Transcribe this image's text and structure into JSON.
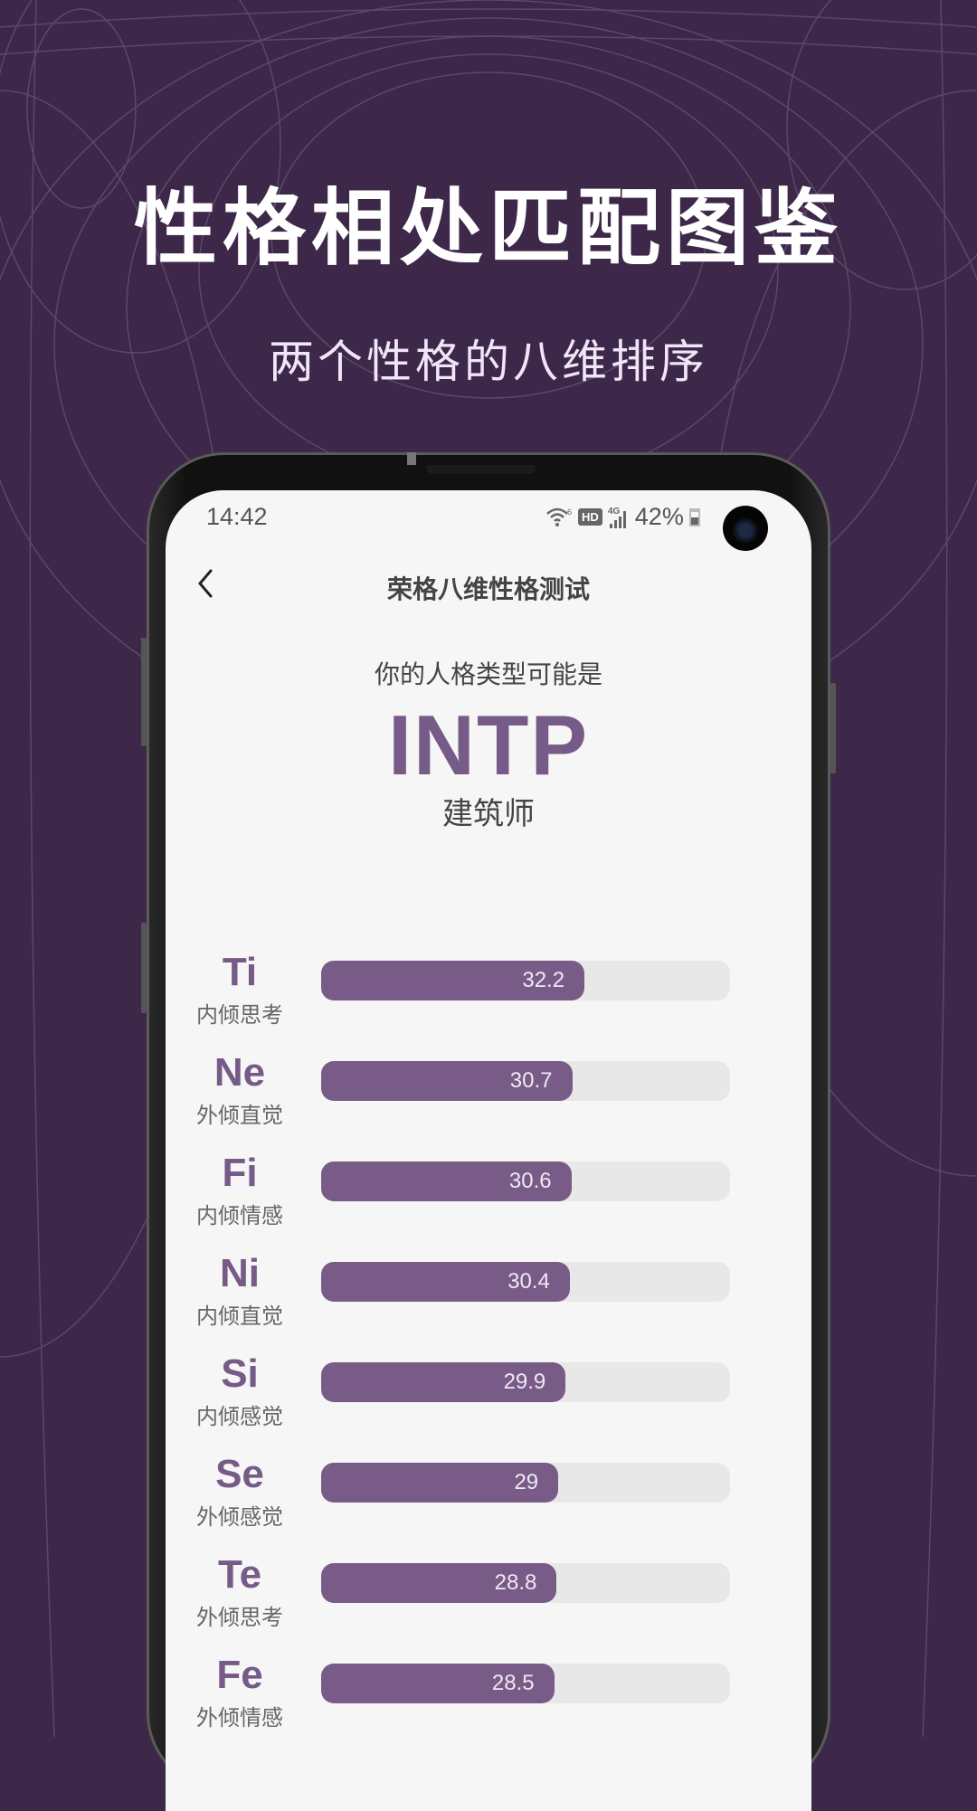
{
  "promo": {
    "title": "性格相处匹配图鉴",
    "subtitle": "两个性格的八维排序"
  },
  "status_bar": {
    "time": "14:42",
    "wifi_icon": "wifi-6-icon",
    "hd_label": "HD",
    "network_label": "4G",
    "signal_icon": "signal-bars-icon",
    "battery_percent": "42%",
    "battery_icon": "battery-icon"
  },
  "nav": {
    "back_icon": "‹",
    "title": "荣格八维性格测试"
  },
  "result": {
    "intro": "你的人格类型可能是",
    "type": "INTP",
    "type_name": "建筑师"
  },
  "colors": {
    "accent": "#785c87",
    "background": "#3d2849",
    "track": "#e8e8e8"
  },
  "chart_data": {
    "type": "bar",
    "orientation": "horizontal",
    "max": 50,
    "categories": [
      "Ti",
      "Ne",
      "Fi",
      "Ni",
      "Si",
      "Se",
      "Te",
      "Fe"
    ],
    "subtitles": [
      "内倾思考",
      "外倾直觉",
      "内倾情感",
      "内倾直觉",
      "内倾感觉",
      "外倾感觉",
      "外倾思考",
      "外倾情感"
    ],
    "values": [
      32.2,
      30.7,
      30.6,
      30.4,
      29.9,
      29,
      28.8,
      28.5
    ]
  },
  "functions": [
    {
      "code": "Ti",
      "name": "内倾思考",
      "value": "32.2"
    },
    {
      "code": "Ne",
      "name": "外倾直觉",
      "value": "30.7"
    },
    {
      "code": "Fi",
      "name": "内倾情感",
      "value": "30.6"
    },
    {
      "code": "Ni",
      "name": "内倾直觉",
      "value": "30.4"
    },
    {
      "code": "Si",
      "name": "内倾感觉",
      "value": "29.9"
    },
    {
      "code": "Se",
      "name": "外倾感觉",
      "value": "29"
    },
    {
      "code": "Te",
      "name": "外倾思考",
      "value": "28.8"
    },
    {
      "code": "Fe",
      "name": "外倾情感",
      "value": "28.5"
    }
  ]
}
